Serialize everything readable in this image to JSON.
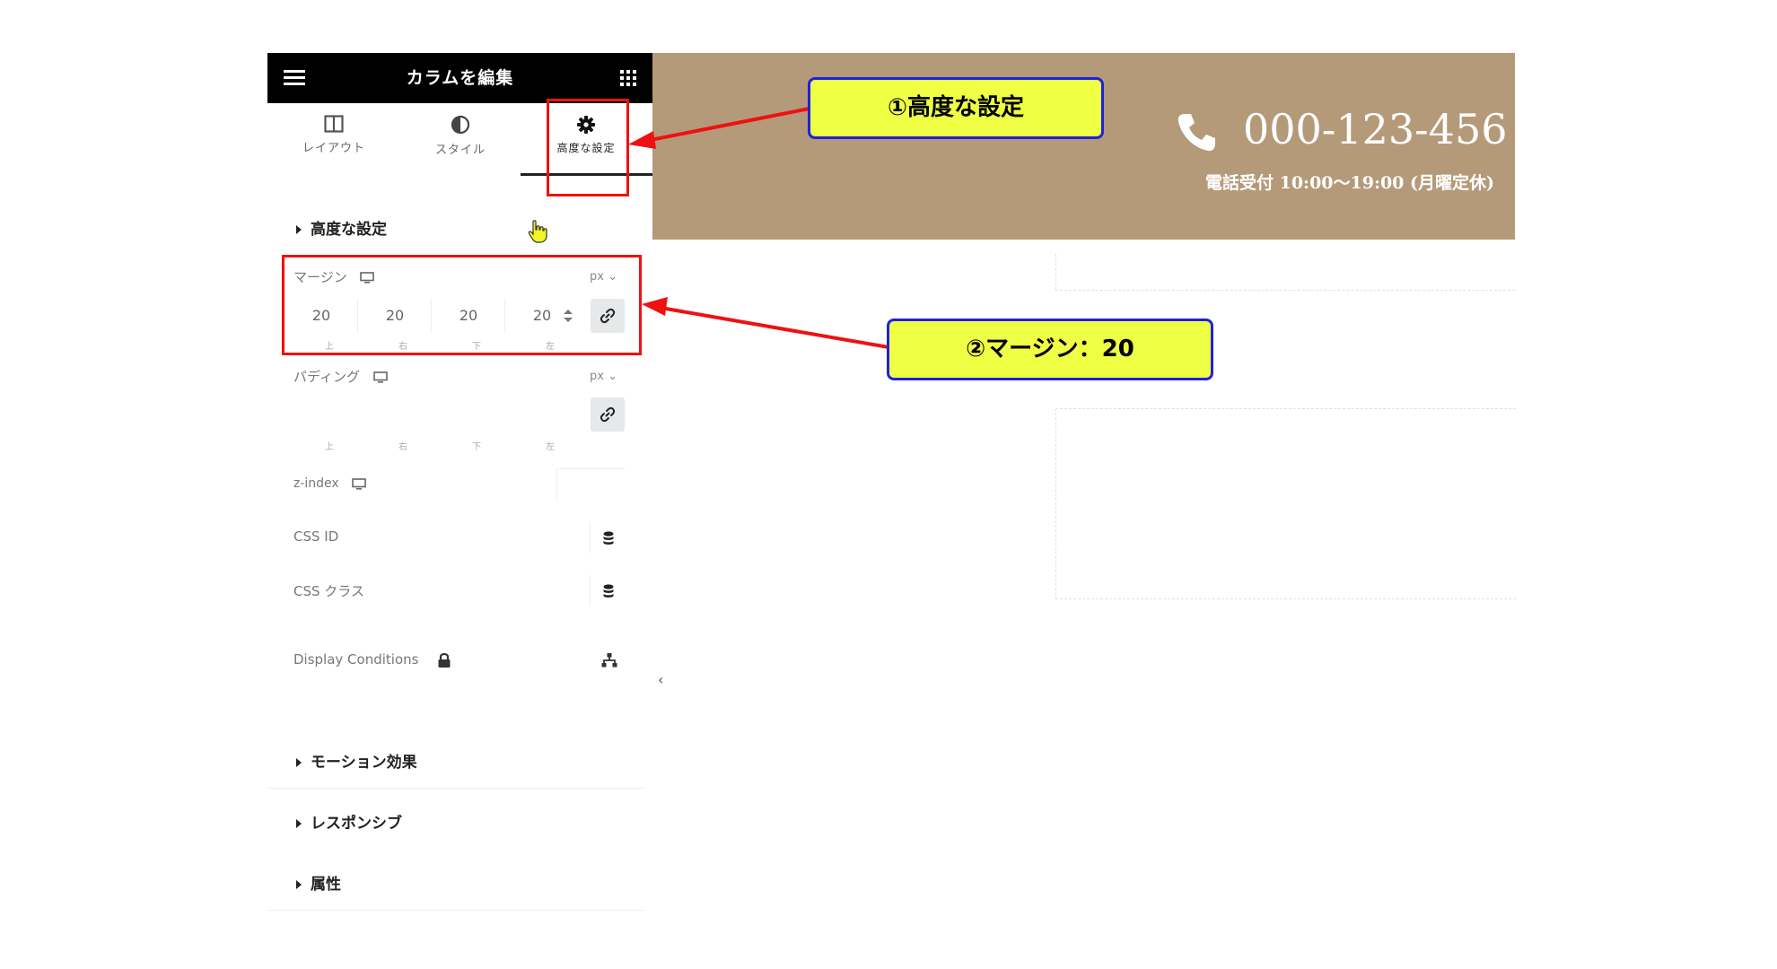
{
  "panel": {
    "title": "カラムを編集",
    "tabs": [
      {
        "label": "レイアウト",
        "icon": "layout-columns-icon"
      },
      {
        "label": "スタイル",
        "icon": "contrast-half-circle-icon"
      },
      {
        "label": "高度な設定",
        "icon": "gear-icon"
      }
    ],
    "active_tab": 2
  },
  "advanced": {
    "section_title": "高度な設定",
    "margin": {
      "label": "マージン",
      "unit": "px",
      "values": [
        "20",
        "20",
        "20",
        "20"
      ],
      "sides": [
        "上",
        "右",
        "下",
        "左"
      ]
    },
    "padding": {
      "label": "パディング",
      "unit": "px",
      "sides": [
        "上",
        "右",
        "下",
        "左"
      ]
    },
    "zindex_label": "z-index",
    "css_id_label": "CSS ID",
    "css_class_label": "CSS クラス",
    "display_conditions_label": "Display Conditions"
  },
  "collapsed_sections": [
    "モーション効果",
    "レスポンシブ",
    "属性"
  ],
  "preview": {
    "phone": "000-123-456",
    "hours": "電話受付 10:00〜19:00 (月曜定休)",
    "banner_color": "#b59a79"
  },
  "annotations": {
    "callout1": "①高度な設定",
    "callout2": "②マージン：20",
    "callout_fill": "#eeff44",
    "callout_border": "#2020e0",
    "highlight_color": "#ee1111"
  }
}
